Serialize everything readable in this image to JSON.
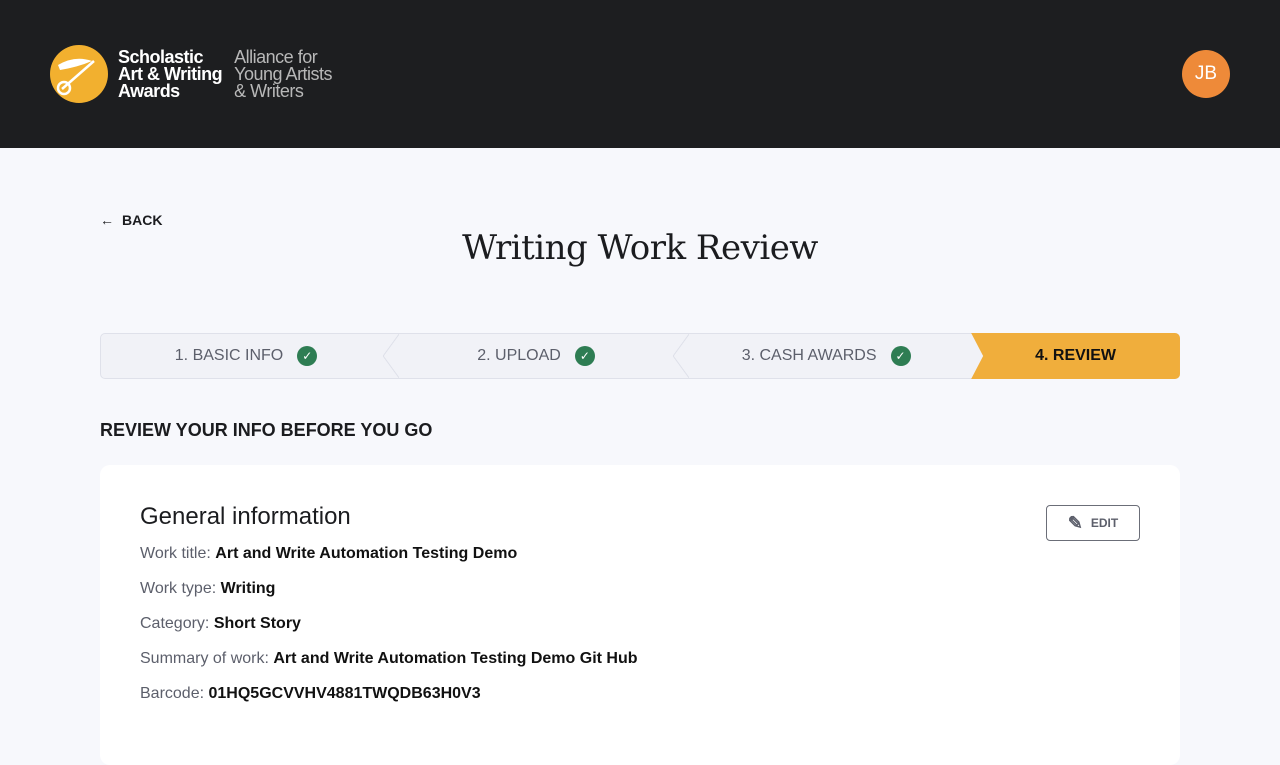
{
  "header": {
    "brand": "Scholastic Art & Writing Awards",
    "alliance": "Alliance for Young Artists & Writers",
    "avatar": "JB"
  },
  "back_label": "BACK",
  "title": "Writing Work Review",
  "steps": [
    {
      "label": "1. BASIC INFO",
      "done": true
    },
    {
      "label": "2. UPLOAD",
      "done": true
    },
    {
      "label": "3. CASH AWARDS",
      "done": true
    },
    {
      "label": "4. REVIEW",
      "active": true
    }
  ],
  "subtitle": "REVIEW YOUR INFO BEFORE YOU GO",
  "card": {
    "heading": "General information",
    "edit": "EDIT",
    "rows": [
      {
        "label": "Work title:",
        "value": "Art and Write Automation Testing Demo"
      },
      {
        "label": "Work type:",
        "value": "Writing"
      },
      {
        "label": "Category:",
        "value": "Short Story"
      },
      {
        "label": "Summary of work:",
        "value": "Art and Write Automation Testing Demo Git Hub"
      },
      {
        "label": "Barcode:",
        "value": "01HQ5GCVVHV4881TWQDB63H0V3"
      }
    ]
  },
  "colors": {
    "accent": "#f0ae3c",
    "check": "#2e7d53",
    "avatar": "#ee8a39"
  }
}
